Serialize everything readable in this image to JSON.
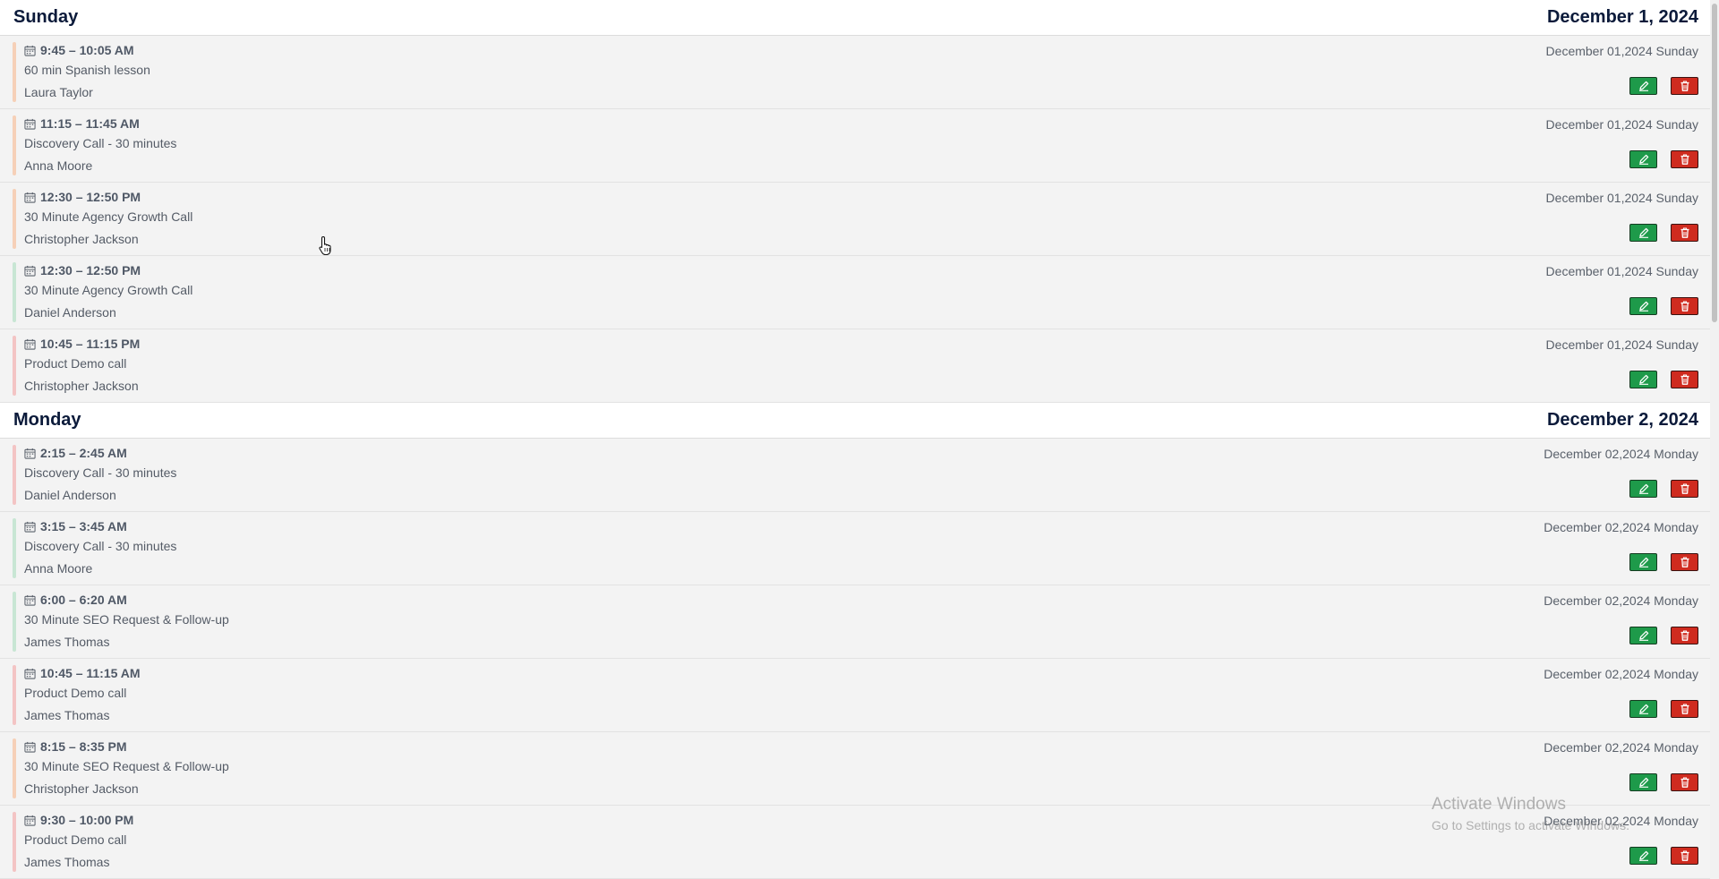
{
  "days": [
    {
      "name": "Sunday",
      "date": "December 1, 2024",
      "events": [
        {
          "time": "9:45 – 10:05 AM",
          "title": "60 min Spanish lesson",
          "person": "Laura Taylor",
          "date_label": "December 01,2024 Sunday",
          "accent": "#f6d0b8"
        },
        {
          "time": "11:15 – 11:45 AM",
          "title": "Discovery Call - 30 minutes",
          "person": "Anna Moore",
          "date_label": "December 01,2024 Sunday",
          "accent": "#f6d0b8"
        },
        {
          "time": "12:30 – 12:50 PM",
          "title": "30 Minute Agency Growth Call",
          "person": "Christopher Jackson",
          "date_label": "December 01,2024 Sunday",
          "accent": "#f6d0b8"
        },
        {
          "time": "12:30 – 12:50 PM",
          "title": "30 Minute Agency Growth Call",
          "person": "Daniel Anderson",
          "date_label": "December 01,2024 Sunday",
          "accent": "#c8e6d4"
        },
        {
          "time": "10:45 – 11:15 PM",
          "title": "Product Demo call",
          "person": "Christopher Jackson",
          "date_label": "December 01,2024 Sunday",
          "accent": "#f3c4c4"
        }
      ]
    },
    {
      "name": "Monday",
      "date": "December 2, 2024",
      "events": [
        {
          "time": "2:15 – 2:45 AM",
          "title": "Discovery Call - 30 minutes",
          "person": "Daniel Anderson",
          "date_label": "December 02,2024 Monday",
          "accent": "#f3c4c4"
        },
        {
          "time": "3:15 – 3:45 AM",
          "title": "Discovery Call - 30 minutes",
          "person": "Anna Moore",
          "date_label": "December 02,2024 Monday",
          "accent": "#c8e6d4"
        },
        {
          "time": "6:00 – 6:20 AM",
          "title": "30 Minute SEO Request & Follow-up",
          "person": "James Thomas",
          "date_label": "December 02,2024 Monday",
          "accent": "#c8e6d4"
        },
        {
          "time": "10:45 – 11:15 AM",
          "title": "Product Demo call",
          "person": "James Thomas",
          "date_label": "December 02,2024 Monday",
          "accent": "#f3c4c4"
        },
        {
          "time": "8:15 – 8:35 PM",
          "title": "30 Minute SEO Request & Follow-up",
          "person": "Christopher Jackson",
          "date_label": "December 02,2024 Monday",
          "accent": "#f6d0b8"
        },
        {
          "time": "9:30 – 10:00 PM",
          "title": "Product Demo call",
          "person": "James Thomas",
          "date_label": "December 02,2024 Monday",
          "accent": "#f3c4c4"
        }
      ]
    }
  ],
  "watermark": {
    "title": "Activate Windows",
    "subtitle": "Go to Settings to activate Windows."
  },
  "colors": {
    "edit_button": "#1e9a4a",
    "delete_button": "#cf2b1f",
    "header_text": "#0b1a3a"
  },
  "icons": {
    "event": "calendar-icon",
    "edit": "pencil-icon",
    "delete": "trash-icon",
    "cursor": "hand-pointer-icon"
  }
}
